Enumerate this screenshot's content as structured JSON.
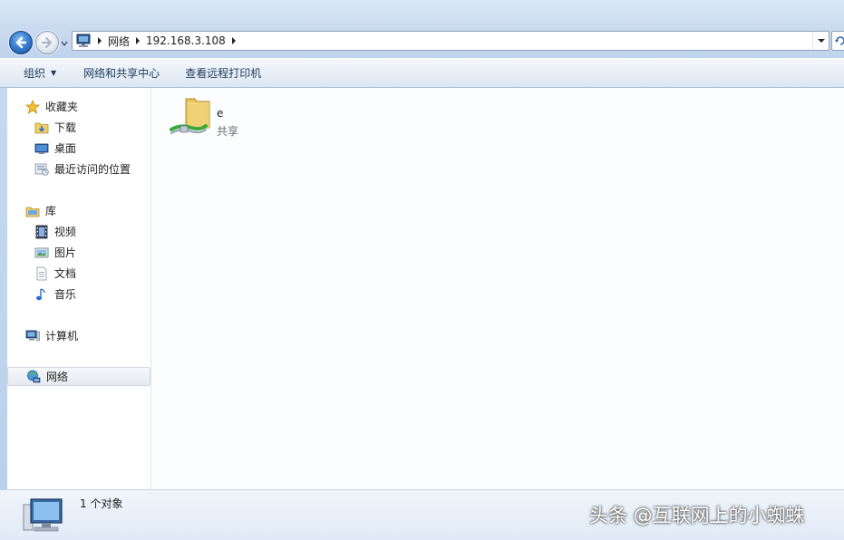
{
  "address_bar": {
    "crumbs": [
      "网络",
      "192.168.3.108"
    ],
    "location_icon": "computer-icon"
  },
  "toolbar": {
    "organize": "组织",
    "network_center": "网络和共享中心",
    "remote_printers": "查看远程打印机"
  },
  "nav": {
    "favorites": {
      "label": "收藏夹",
      "icon": "star-icon",
      "items": [
        {
          "label": "下载",
          "icon": "download-folder-icon"
        },
        {
          "label": "桌面",
          "icon": "desktop-icon"
        },
        {
          "label": "最近访问的位置",
          "icon": "recent-places-icon"
        }
      ]
    },
    "libraries": {
      "label": "库",
      "icon": "library-icon",
      "items": [
        {
          "label": "视频",
          "icon": "video-icon"
        },
        {
          "label": "图片",
          "icon": "picture-icon"
        },
        {
          "label": "文档",
          "icon": "document-icon"
        },
        {
          "label": "音乐",
          "icon": "music-icon"
        }
      ]
    },
    "computer": {
      "label": "计算机",
      "icon": "computer-icon"
    },
    "network": {
      "label": "网络",
      "icon": "network-icon",
      "selected": true
    }
  },
  "content": {
    "items": [
      {
        "name": "e",
        "type": "共享",
        "icon": "shared-folder-icon"
      }
    ]
  },
  "details": {
    "count": "1 个对象",
    "icon": "computer-icon"
  },
  "watermark": "头条 @互联网上的小蜘蛛",
  "colors": {
    "back_button": "#3a7fd0",
    "selected_nav": "#e6eaf0",
    "toolbar_text": "#1e395b"
  }
}
